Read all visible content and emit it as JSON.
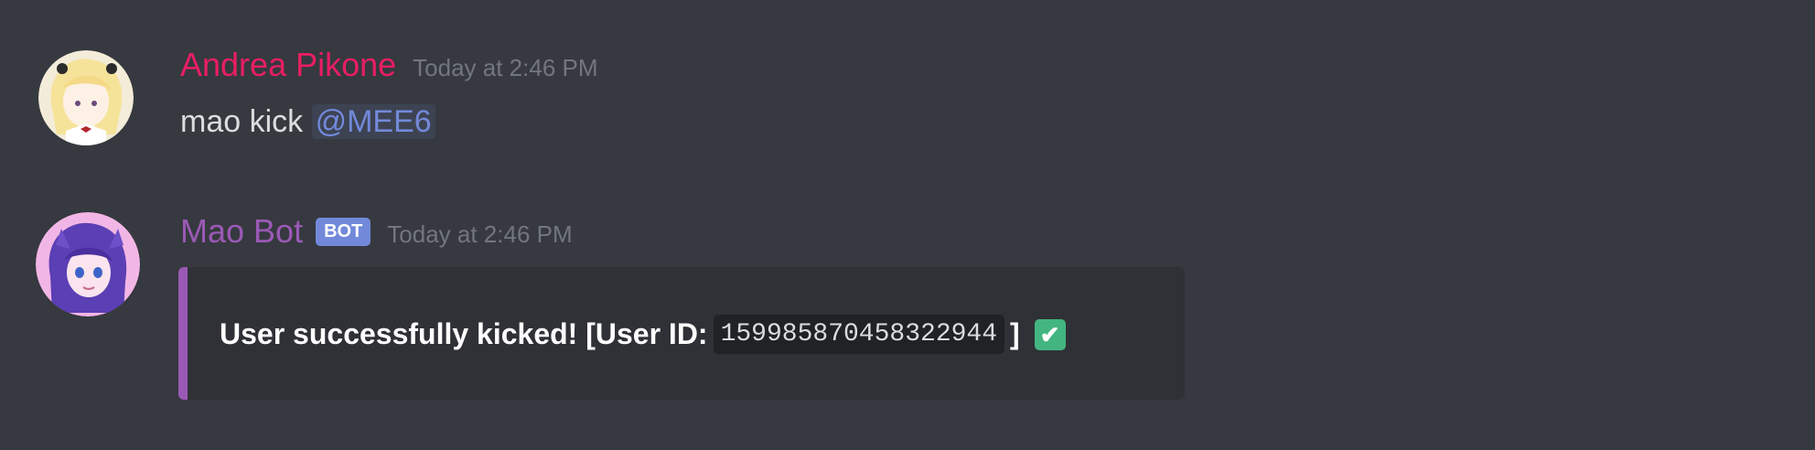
{
  "messages": [
    {
      "author": "Andrea Pikone",
      "author_color": "#e91e63",
      "timestamp": "Today at 2:46 PM",
      "text": "mao kick",
      "mention": "@MEE6"
    },
    {
      "author": "Mao Bot",
      "author_color": "#9b59b6",
      "bot_tag": "BOT",
      "timestamp": "Today at 2:46 PM",
      "embed": {
        "accent_color": "#9b59b6",
        "text_before": "User successfully kicked! [User ID:",
        "user_id": "159985870458322944",
        "text_after": "]",
        "emoji": "white-check-mark-icon"
      }
    }
  ]
}
